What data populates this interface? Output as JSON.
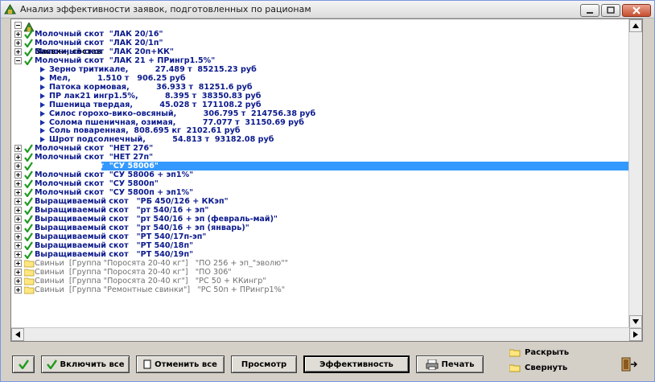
{
  "window": {
    "title": "Анализ эффективности заявок, подготовленных по рационам"
  },
  "tree": {
    "root_label": "Заявки, состав",
    "items": [
      {
        "label": "Молочный скот  \"ЛАК 20/16\"",
        "kind": "checked",
        "expander": "plus"
      },
      {
        "label": "Молочный скот  \"ЛАК 20/1п\"",
        "kind": "checked",
        "expander": "plus"
      },
      {
        "label": "Молочный скот  \"ЛАК 20п+КК\"",
        "kind": "checked",
        "expander": "plus"
      },
      {
        "label": "Молочный скот  \"ЛАК 21 + ПРингр1.5%\"",
        "kind": "checked",
        "expander": "minus"
      },
      {
        "label": "Зерно тритикале,          27.489 т  85215.23 руб",
        "kind": "child"
      },
      {
        "label": "Мел,          1.510 т   906.25 руб",
        "kind": "child"
      },
      {
        "label": "Патока кормовая,          36.933 т  81251.6 руб",
        "kind": "child"
      },
      {
        "label": "ПР лак21 ингр1.5%,          8.395 т  38350.83 руб",
        "kind": "child"
      },
      {
        "label": "Пшеница твердая,          45.028 т  171108.2 руб",
        "kind": "child"
      },
      {
        "label": "Силос горохо-вико-овсяный,          306.795 т  214756.38 руб",
        "kind": "child"
      },
      {
        "label": "Солома пшеничная, озимая,          77.077 т  31150.69 руб",
        "kind": "child"
      },
      {
        "label": "Соль поваренная,  808.695 кг  2102.61 руб",
        "kind": "child"
      },
      {
        "label": "Шрот подсолнечный,          54.813 т  93182.08 руб",
        "kind": "child"
      },
      {
        "label": "Молочный скот  \"НЕТ 276\"",
        "kind": "checked",
        "expander": "plus"
      },
      {
        "label": "Молочный скот  \"НЕТ 27п\"",
        "kind": "checked",
        "expander": "plus"
      },
      {
        "label": "Молочный скот  \"СУ 58006\"",
        "kind": "checked",
        "expander": "plus",
        "selected": true
      },
      {
        "label": "Молочный скот  \"СУ 58006 + эп1%\"",
        "kind": "checked",
        "expander": "plus"
      },
      {
        "label": "Молочный скот  \"СУ 5800п\"",
        "kind": "checked",
        "expander": "plus"
      },
      {
        "label": "Молочный скот  \"СУ 5800п + эп1%\"",
        "kind": "checked",
        "expander": "plus"
      },
      {
        "label": "Выращиваемый скот   \"РБ 450/126 + ККэп\"",
        "kind": "checked",
        "expander": "plus"
      },
      {
        "label": "Выращиваемый скот   \"рт 540/16 + эп\"",
        "kind": "checked",
        "expander": "plus"
      },
      {
        "label": "Выращиваемый скот   \"рт 540/16 + эп (февраль-май)\"",
        "kind": "checked",
        "expander": "plus"
      },
      {
        "label": "Выращиваемый скот   \"рт 540/16 + эп (январь)\"",
        "kind": "checked",
        "expander": "plus"
      },
      {
        "label": "Выращиваемый скот   \"РТ 540/17п-эп\"",
        "kind": "checked",
        "expander": "plus"
      },
      {
        "label": "Выращиваемый скот   \"РТ 540/18п\"",
        "kind": "checked",
        "expander": "plus"
      },
      {
        "label": "Выращиваемый скот   \"РТ 540/19п\"",
        "kind": "checked",
        "expander": "plus"
      },
      {
        "label": "Свиньи  [Группа \"Поросята 20-40 кг\"]   \"ПО 256 + эп_\"эволю\"\"",
        "kind": "folder",
        "expander": "plus"
      },
      {
        "label": "Свиньи  [Группа \"Поросята 20-40 кг\"]   \"ПО 306\"",
        "kind": "folder",
        "expander": "plus"
      },
      {
        "label": "Свиньи  [Группа \"Поросята 20-40 кг\"]   \"РС 50 + ККингр\"",
        "kind": "folder",
        "expander": "plus"
      },
      {
        "label": "Свиньи  [Группа \"Ремонтные свинки\"]   \"РС 50п + ПРингр1%\"",
        "kind": "folder",
        "expander": "plus"
      }
    ]
  },
  "toolbar": {
    "include_all": "Включить все",
    "cancel_all": "Отменить все",
    "preview": "Просмотр",
    "efficiency": "Эффективность",
    "print": "Печать",
    "expand": "Раскрыть",
    "collapse": "Свернуть"
  },
  "colors": {
    "selection": "#3399ff",
    "item_text": "#0b1a8c",
    "pig_text": "#707070",
    "check": "#1f9a1f"
  }
}
